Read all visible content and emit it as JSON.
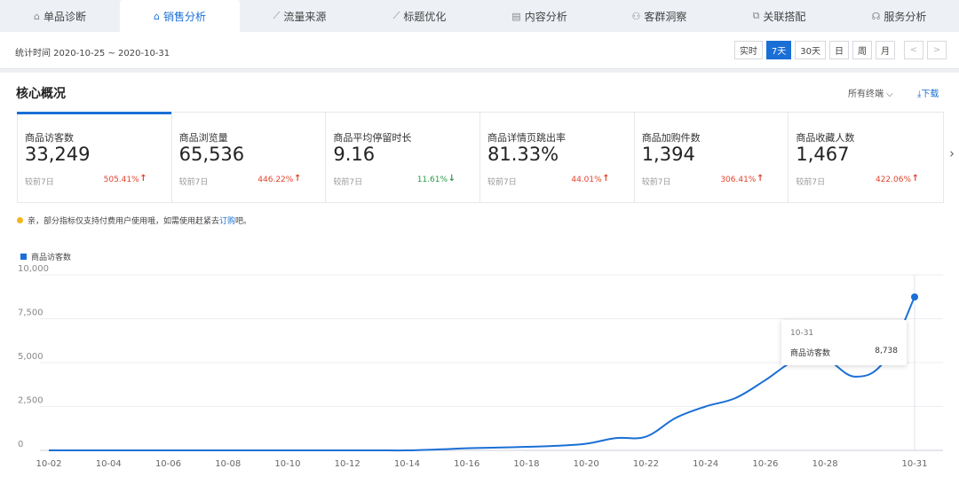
{
  "nav": {
    "items": [
      {
        "label": "单品诊断",
        "icon": "home-icon",
        "glyph": "⌂"
      },
      {
        "label": "销售分析",
        "icon": "home-icon",
        "glyph": "⌂"
      },
      {
        "label": "流量来源",
        "icon": "trend-icon",
        "glyph": "⟋"
      },
      {
        "label": "标题优化",
        "icon": "trend-icon",
        "glyph": "⟋"
      },
      {
        "label": "内容分析",
        "icon": "document-icon",
        "glyph": "▤"
      },
      {
        "label": "客群洞察",
        "icon": "users-icon",
        "glyph": "⚇"
      },
      {
        "label": "关联搭配",
        "icon": "link-icon",
        "glyph": "⧉"
      },
      {
        "label": "服务分析",
        "icon": "headset-icon",
        "glyph": "☊"
      }
    ],
    "active_index": 1
  },
  "datebar": {
    "date_range": "统计时间 2020-10-25 ~ 2020-10-31",
    "buttons": [
      "实时",
      "7天",
      "30天",
      "日",
      "周",
      "月",
      "<",
      ">"
    ],
    "active_button": "7天"
  },
  "section": {
    "title": "核心概况",
    "terminal_select": "所有终端 ⌵",
    "download": "⤓下载"
  },
  "cards": [
    {
      "label": "商品访客数",
      "value": "33,249",
      "compare_label": "较前7日",
      "change": "505.41%",
      "direction": "up"
    },
    {
      "label": "商品浏览量",
      "value": "65,536",
      "compare_label": "较前7日",
      "change": "446.22%",
      "direction": "up"
    },
    {
      "label": "商品平均停留时长",
      "value": "9.16",
      "compare_label": "较前7日",
      "change": "11.61%",
      "direction": "down"
    },
    {
      "label": "商品详情页跳出率",
      "value": "81.33%",
      "compare_label": "较前7日",
      "change": "44.01%",
      "direction": "up"
    },
    {
      "label": "商品加购件数",
      "value": "1,394",
      "compare_label": "较前7日",
      "change": "306.41%",
      "direction": "up"
    },
    {
      "label": "商品收藏人数",
      "value": "1,467",
      "compare_label": "较前7日",
      "change": "422.06%",
      "direction": "up"
    }
  ],
  "notice": {
    "text": "亲，部分指标仅支持付费用户使用哦，如需使用赶紧去",
    "link": "订购",
    "suffix": "吧。"
  },
  "tooltip": {
    "date": "10-31",
    "name": "商品访客数",
    "value": "8,738"
  },
  "colors": {
    "accent": "#1a6fd6",
    "up": "#e2432c",
    "down": "#2a9a4a",
    "notice": "#f3b51c"
  },
  "chart_data": {
    "type": "line",
    "series": [
      {
        "name": "商品访客数",
        "x": [
          "10-02",
          "10-03",
          "10-04",
          "10-05",
          "10-06",
          "10-07",
          "10-08",
          "10-09",
          "10-10",
          "10-11",
          "10-12",
          "10-13",
          "10-14",
          "10-15",
          "10-16",
          "10-17",
          "10-18",
          "10-19",
          "10-20",
          "10-21",
          "10-22",
          "10-23",
          "10-24",
          "10-25",
          "10-26",
          "10-27",
          "10-28",
          "10-29",
          "10-30",
          "10-31"
        ],
        "values": [
          0,
          0,
          0,
          0,
          0,
          0,
          0,
          0,
          0,
          0,
          0,
          0,
          0,
          50,
          120,
          160,
          200,
          260,
          380,
          700,
          780,
          1850,
          2500,
          2980,
          4000,
          5100,
          5200,
          4200,
          5100,
          8738
        ]
      }
    ],
    "x_tick_labels": [
      "10-02",
      "10-04",
      "10-06",
      "10-08",
      "10-10",
      "10-12",
      "10-14",
      "10-16",
      "10-18",
      "10-20",
      "10-22",
      "10-24",
      "10-26",
      "10-28",
      "10-31"
    ],
    "y_tick_labels": [
      "0",
      "2,500",
      "5,000",
      "7,500",
      "10,000"
    ],
    "y_ticks": [
      0,
      2500,
      5000,
      7500,
      10000
    ],
    "ylim": [
      0,
      10000
    ],
    "grid": true,
    "legend": "top-left",
    "highlighted_point": "10-31"
  }
}
